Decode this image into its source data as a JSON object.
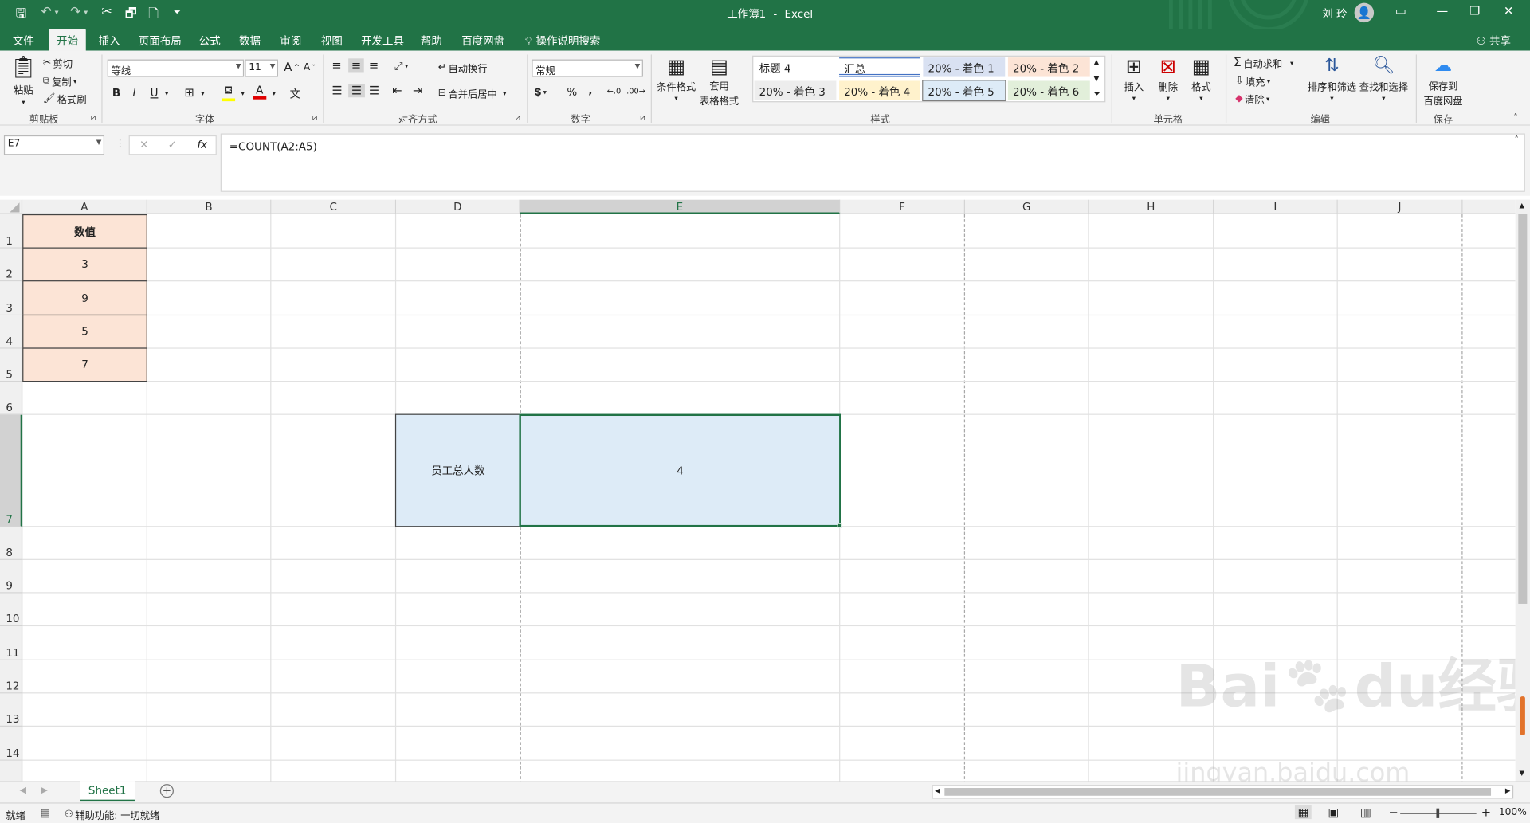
{
  "title": {
    "doc": "工作簿1",
    "sep": "-",
    "app": "Excel",
    "user": "刘 玲",
    "avatar": "👤"
  },
  "ribbon_tabs": [
    "文件",
    "开始",
    "插入",
    "页面布局",
    "公式",
    "数据",
    "审阅",
    "视图",
    "开发工具",
    "帮助",
    "百度网盘"
  ],
  "active_tab": "开始",
  "tell_me": "操作说明搜索",
  "share": "共享",
  "clipboard": {
    "paste": "粘贴",
    "cut": "剪切",
    "copy": "复制",
    "format_painter": "格式刷",
    "label": "剪贴板"
  },
  "font": {
    "name": "等线",
    "size": "11",
    "bold": "B",
    "italic": "I",
    "underline": "U",
    "grow": "A",
    "shrink": "A",
    "label": "字体"
  },
  "alignment": {
    "wrap": "自动换行",
    "merge": "合并后居中",
    "label": "对齐方式"
  },
  "number": {
    "format": "常规",
    "percent": "%",
    "comma": ",",
    "label": "数字"
  },
  "styles": {
    "conditional": "条件格式",
    "table_line1": "套用",
    "table_line2": "表格格式",
    "cells": [
      "标题 4",
      "汇总",
      "20% - 着色 1",
      "20% - 着色 2",
      "20% - 着色 3",
      "20% - 着色 4",
      "20% - 着色 5",
      "20% - 着色 6"
    ],
    "label": "样式"
  },
  "cells_group": {
    "insert": "插入",
    "delete": "删除",
    "format": "格式",
    "label": "单元格"
  },
  "editing": {
    "autosum": "自动求和",
    "fill": "填充",
    "clear": "清除",
    "sort": "排序和筛选",
    "find": "查找和选择",
    "label": "编辑"
  },
  "save_group": {
    "line1": "保存到",
    "line2": "百度网盘",
    "label": "保存"
  },
  "name_box": "E7",
  "formula": "=COUNT(A2:A5)",
  "fx": "fx",
  "columns": [
    "A",
    "B",
    "C",
    "D",
    "E",
    "F",
    "G",
    "H",
    "I",
    "J"
  ],
  "rows": [
    "1",
    "2",
    "3",
    "4",
    "5",
    "6",
    "7",
    "8",
    "9",
    "10",
    "11",
    "12",
    "13",
    "14"
  ],
  "cells": {
    "A1": "数值",
    "A2": "3",
    "A3": "9",
    "A4": "5",
    "A5": "7",
    "D7": "员工总人数",
    "E7": "4"
  },
  "sheet": {
    "tab": "Sheet1",
    "add": "+"
  },
  "status": {
    "ready": "就绪",
    "accessibility": "辅助功能: 一切就绪",
    "zoom": "100%",
    "minus": "−",
    "plus": "+"
  },
  "watermark": {
    "brand": "Bai",
    "brand2": "du",
    "cn": "经验",
    "url": "jingyan.baidu.com"
  },
  "colors": {
    "excel_green": "#217346",
    "salmon": "#fce4d6",
    "lightblue": "#ddebf7",
    "annotation_red": "#e8262d"
  }
}
